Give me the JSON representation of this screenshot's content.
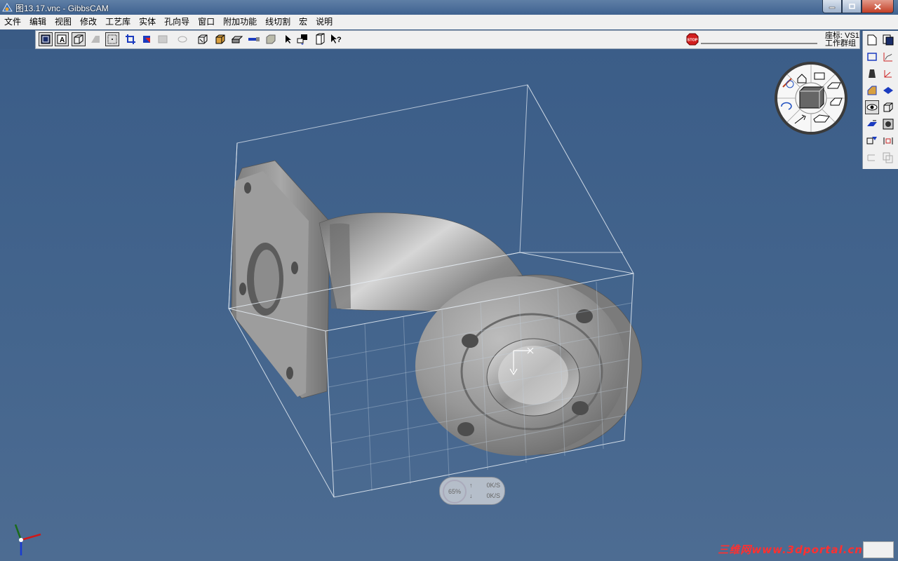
{
  "window": {
    "title": "图13.17.vnc - GibbsCAM"
  },
  "menu": {
    "items": [
      {
        "id": "file",
        "label": "文件"
      },
      {
        "id": "edit",
        "label": "编辑"
      },
      {
        "id": "view",
        "label": "视图"
      },
      {
        "id": "modify",
        "label": "修改"
      },
      {
        "id": "process-library",
        "label": "工艺库"
      },
      {
        "id": "solid",
        "label": "实体"
      },
      {
        "id": "hole-wizard",
        "label": "孔向导"
      },
      {
        "id": "window",
        "label": "窗口"
      },
      {
        "id": "plugins",
        "label": "附加功能"
      },
      {
        "id": "wire-edm",
        "label": "线切割"
      },
      {
        "id": "macro",
        "label": "宏"
      },
      {
        "id": "help",
        "label": "说明"
      }
    ]
  },
  "toolbar": {
    "stop_label": "STOP",
    "coord_label": "座标: VS1",
    "workgroup_label": "工作群组"
  },
  "status": {
    "percent": "65%",
    "upload": "0K/S",
    "download": "0K/S"
  },
  "watermark": {
    "text": "三维网www.3dportal.cn"
  },
  "colors": {
    "viewport_bg": "#44658d",
    "part": "#9a9a9a",
    "titlebar": "#4a6c98"
  }
}
